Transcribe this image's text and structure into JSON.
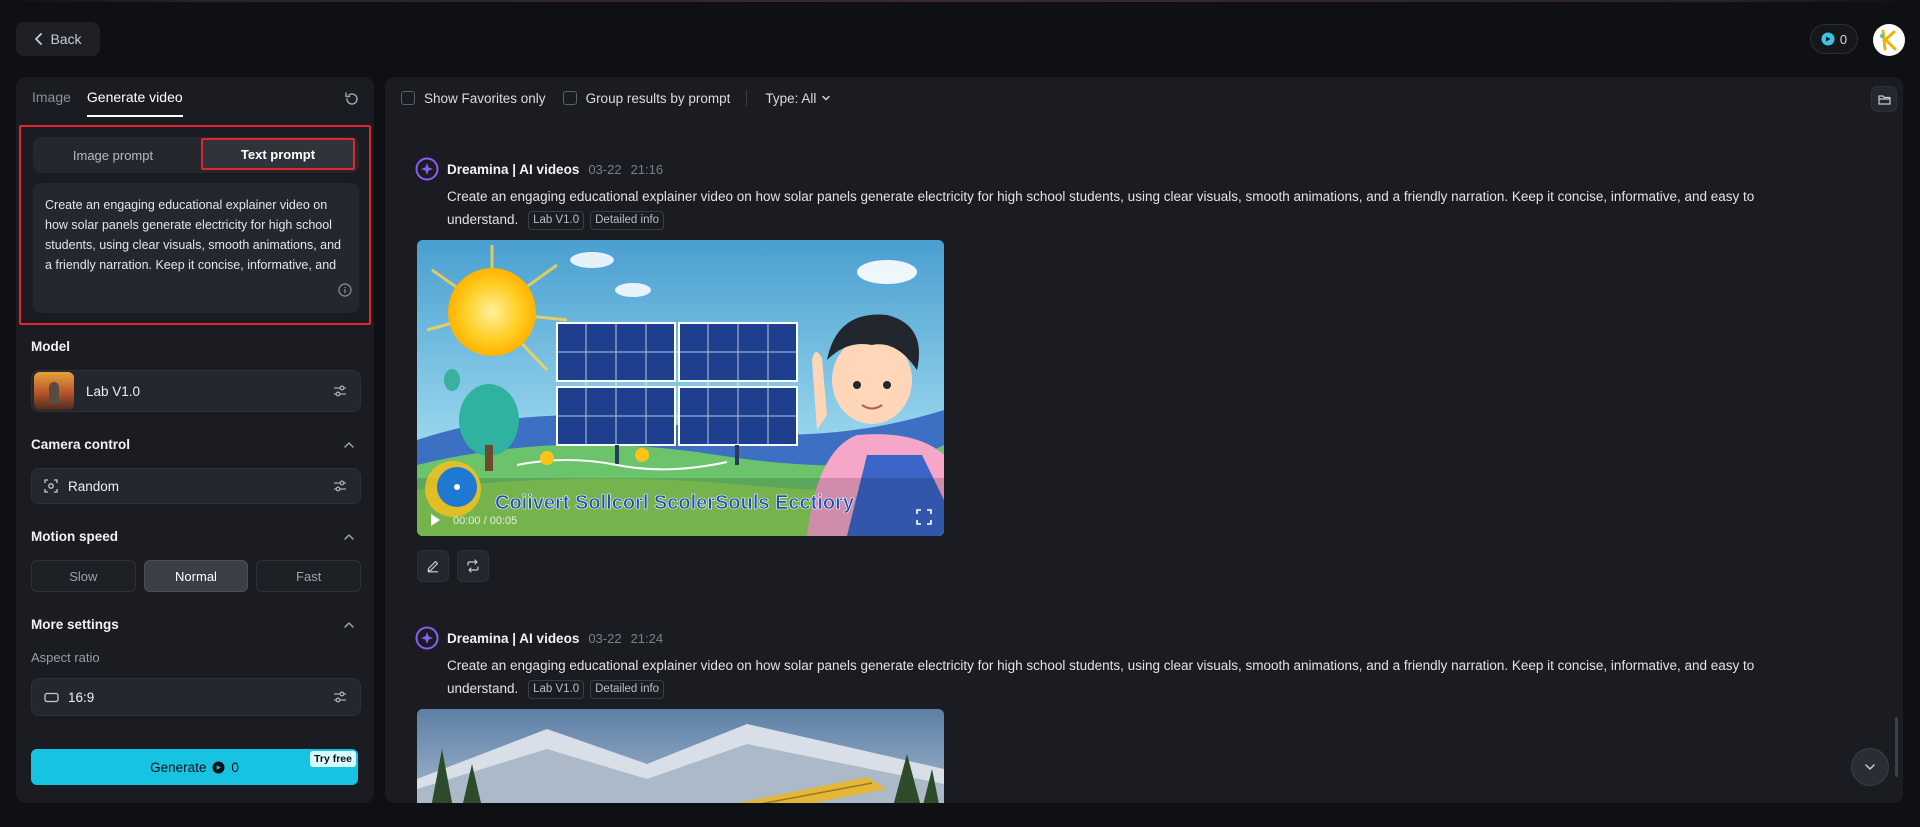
{
  "header": {
    "back_label": "Back",
    "credits": "0",
    "avatar_letter": "K"
  },
  "left": {
    "tabs": [
      {
        "label": "Image"
      },
      {
        "label": "Generate video"
      }
    ],
    "prompt_modes": {
      "image": "Image prompt",
      "text": "Text prompt"
    },
    "prompt_text": "Create an engaging educational explainer video on how solar panels generate electricity for high school students, using clear visuals, smooth animations, and a friendly narration. Keep it concise, informative, and easy to understand.",
    "model": {
      "label": "Model",
      "value": "Lab V1.0"
    },
    "camera": {
      "label": "Camera control",
      "value": "Random"
    },
    "motion": {
      "label": "Motion speed",
      "options": [
        "Slow",
        "Normal",
        "Fast"
      ],
      "selected": "Normal"
    },
    "more": {
      "label": "More settings",
      "aspect_label": "Aspect ratio",
      "aspect_value": "16:9"
    },
    "generate": {
      "label": "Generate",
      "cost": "0",
      "badge": "Try free"
    }
  },
  "filters": {
    "favorites": "Show Favorites only",
    "group": "Group results by prompt",
    "type": "Type: All"
  },
  "results": [
    {
      "author": "Dreamina | AI videos",
      "date": "03-22",
      "time": "21:16",
      "prompt": "Create an engaging educational explainer video on how solar panels generate electricity for high school students, using clear visuals, smooth animations, and a friendly narration. Keep it concise, informative, and easy to understand.",
      "tags": [
        "Lab V1.0",
        "Detailed info"
      ],
      "video_caption": "Coiivert Sollcorl ScolerSouls Ecctiory",
      "video_time": "00:00 / 00:05"
    },
    {
      "author": "Dreamina | AI videos",
      "date": "03-22",
      "time": "21:24",
      "prompt": "Create an engaging educational explainer video on how solar panels generate electricity for high school students, using clear visuals, smooth animations, and a friendly narration. Keep it concise, informative, and easy to understand.",
      "tags": [
        "Lab V1.0",
        "Detailed info"
      ]
    }
  ],
  "colors": {
    "accent": "#16c4e2",
    "highlight_border": "#e0262e",
    "panel": "#1a1c21",
    "background": "#0f1013"
  }
}
